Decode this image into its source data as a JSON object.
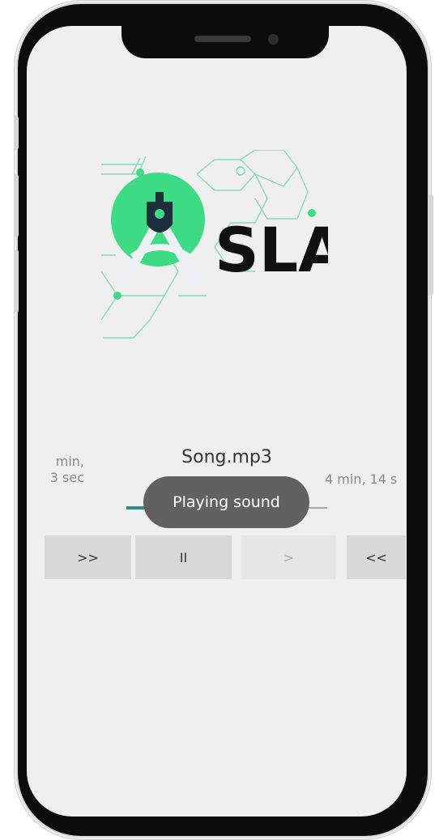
{
  "logo": {
    "text": "SLA"
  },
  "player": {
    "song_title": "Song.mp3",
    "elapsed_line1": "min,",
    "elapsed_line2": "3 sec",
    "duration": "4 min, 14 s",
    "progress_fraction": 0.2
  },
  "toast": {
    "message": "Playing sound"
  },
  "controls": {
    "forward_label": ">>",
    "pause_label": "II",
    "play_label": ">",
    "rewind_label": "<<"
  },
  "colors": {
    "accent": "#2c8a8a",
    "logo_green": "#3ddc84",
    "logo_dark": "#1f2d3d",
    "toast_bg": "#616161"
  }
}
